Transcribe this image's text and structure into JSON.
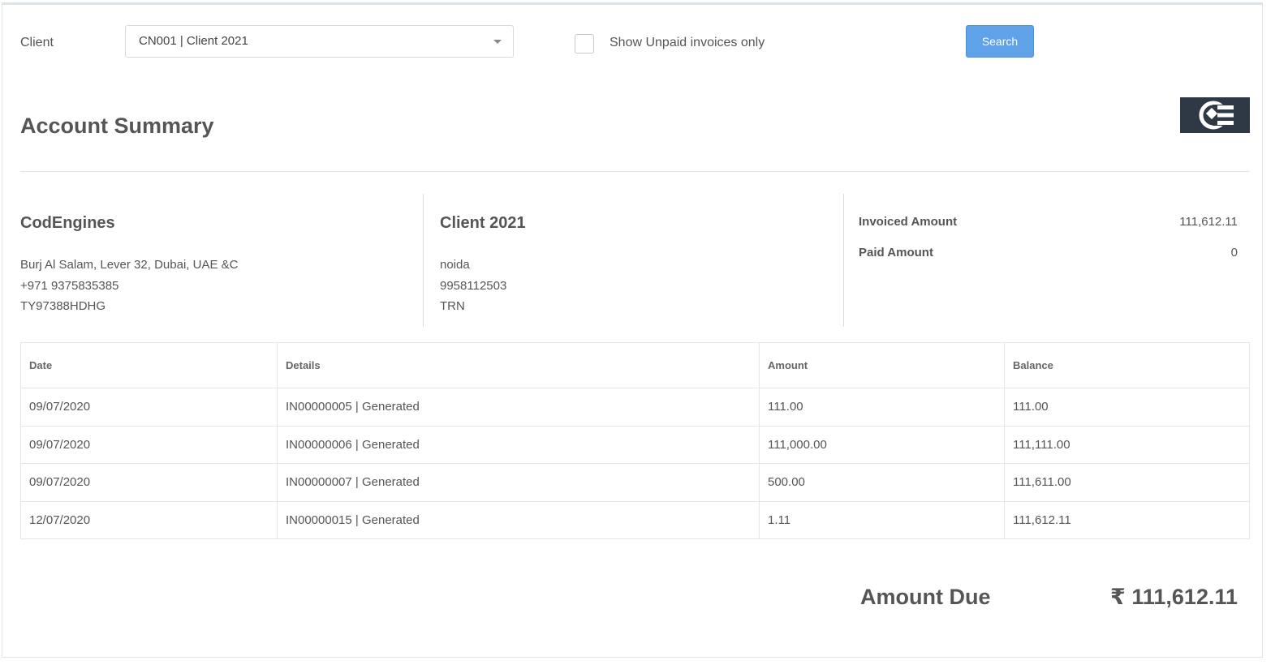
{
  "filter": {
    "client_label": "Client",
    "client_value": "CN001 | Client 2021",
    "unpaid_label": "Show Unpaid invoices only",
    "search_label": "Search"
  },
  "page_title": "Account Summary",
  "company": {
    "name": "CodEngines",
    "address": "Burj Al Salam, Lever 32, Dubai, UAE &C",
    "phone": "+971 9375835385",
    "tax_id": "TY97388HDHG"
  },
  "client": {
    "name": "Client 2021",
    "city": "noida",
    "phone": "9958112503",
    "tax_id": "TRN"
  },
  "summary": {
    "invoiced_label": "Invoiced Amount",
    "invoiced_value": "111,612.11",
    "paid_label": "Paid Amount",
    "paid_value": "0"
  },
  "table": {
    "headers": [
      "Date",
      "Details",
      "Amount",
      "Balance"
    ],
    "rows": [
      [
        "09/07/2020",
        "IN00000005 | Generated",
        "111.00",
        "111.00"
      ],
      [
        "09/07/2020",
        "IN00000006 | Generated",
        "111,000.00",
        "111,111.00"
      ],
      [
        "09/07/2020",
        "IN00000007 | Generated",
        "500.00",
        "111,611.00"
      ],
      [
        "12/07/2020",
        "IN00000015 | Generated",
        "1.11",
        "111,612.11"
      ]
    ]
  },
  "amount_due": {
    "label": "Amount Due",
    "value": "₹ 111,612.11"
  },
  "colors": {
    "button": "#5fa2e8",
    "logo_bg": "#2f3945"
  },
  "icons": {
    "logo": "codengines-logo-icon",
    "dropdown": "chevron-down-icon"
  }
}
